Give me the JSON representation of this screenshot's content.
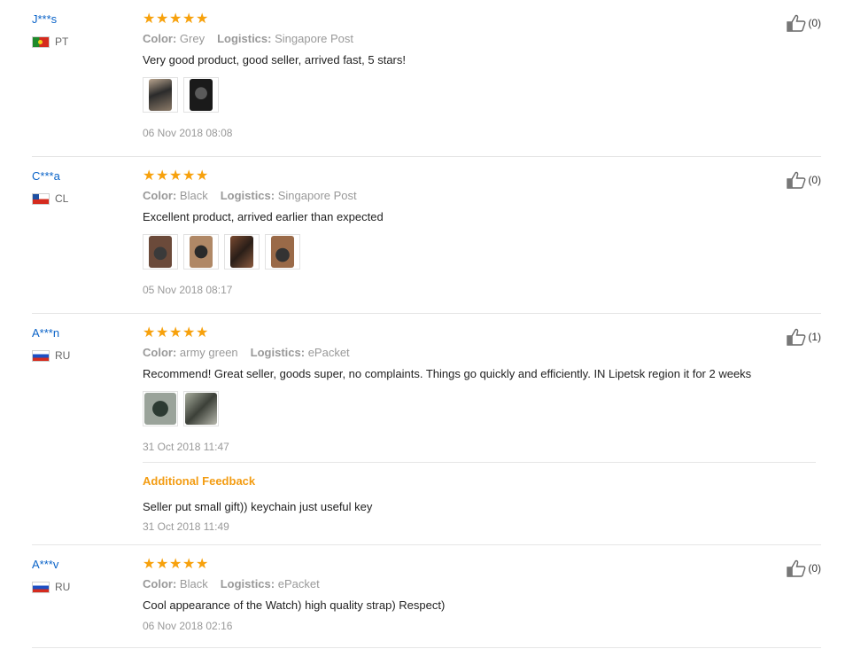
{
  "labels": {
    "color": "Color:",
    "logistics": "Logistics:",
    "additional_feedback": "Additional Feedback"
  },
  "colors": {
    "star": "#f7a10c",
    "username": "#0a63c8",
    "feedback_title": "#f39c12"
  },
  "reviews": [
    {
      "user": "J***s",
      "country": "PT",
      "flag": "flag-pt",
      "rating": 5,
      "color": "Grey",
      "logistics": "Singapore Post",
      "text": "Very good product, good seller, arrived fast, 5 stars!",
      "photo_count": 2,
      "date": "06 Nov 2018 08:08",
      "likes": "(0)"
    },
    {
      "user": "C***a",
      "country": "CL",
      "flag": "flag-cl",
      "rating": 5,
      "color": "Black",
      "logistics": "Singapore Post",
      "text": "Excellent product, arrived earlier than expected",
      "photo_count": 4,
      "date": "05 Nov 2018 08:17",
      "likes": "(0)"
    },
    {
      "user": "A***n",
      "country": "RU",
      "flag": "flag-ru",
      "rating": 5,
      "color": "army green",
      "logistics": "ePacket",
      "text": "Recommend! Great seller, goods super, no complaints. Things go quickly and efficiently. IN Lipetsk region it for 2 weeks",
      "photo_count": 2,
      "date": "31 Oct 2018 11:47",
      "likes": "(1)",
      "additional": {
        "text": "Seller put small gift)) keychain just useful key",
        "date": "31 Oct 2018 11:49"
      }
    },
    {
      "user": "A***v",
      "country": "RU",
      "flag": "flag-ru",
      "rating": 5,
      "color": "Black",
      "logistics": "ePacket",
      "text": "Cool appearance of the Watch) high quality strap) Respect)",
      "photo_count": 0,
      "date": "06 Nov 2018 02:16",
      "likes": "(0)"
    }
  ]
}
